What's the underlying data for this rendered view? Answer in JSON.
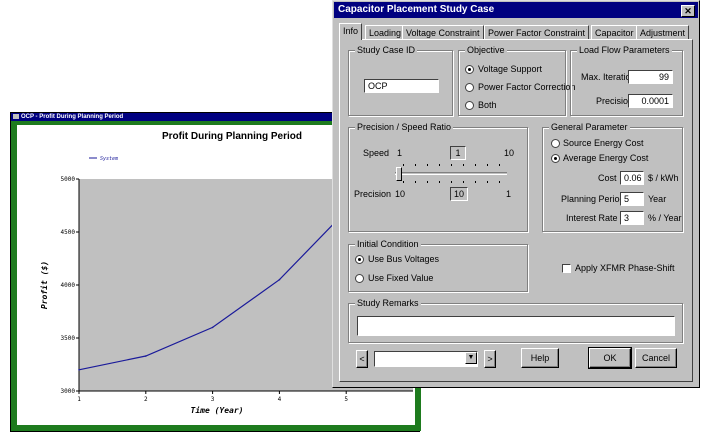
{
  "chart_window": {
    "title": "OCP - Profit During Planning Period"
  },
  "chart_data": {
    "type": "line",
    "title": "Profit During Planning Period",
    "xlabel": "Time (Year)",
    "ylabel": "Profit ($)",
    "x": [
      1,
      2,
      3,
      4,
      5
    ],
    "series": [
      {
        "name": "System",
        "values": [
          3200,
          3330,
          3600,
          4050,
          4700
        ]
      }
    ],
    "x_ticks": [
      "1",
      "2",
      "3",
      "4",
      "5"
    ],
    "y_ticks": [
      "3000",
      "3500",
      "4000",
      "4500",
      "5000"
    ],
    "ylim": [
      3000,
      5000
    ],
    "xlim": [
      1,
      6
    ],
    "grid": false,
    "legend": "top-left",
    "plot_bg": "#c0c0c0",
    "line_color": "#1a1a9a"
  },
  "dialog": {
    "title": "Capacitor Placement Study Case",
    "close_icon": "close-icon",
    "tabs": [
      "Info",
      "Loading",
      "Voltage Constraint",
      "Power Factor Constraint",
      "Capacitor",
      "Adjustment"
    ],
    "active_tab": "Info",
    "study_case_id": {
      "label": "Study Case ID",
      "value": "OCP"
    },
    "objective": {
      "label": "Objective",
      "options": [
        "Voltage Support",
        "Power Factor Correction",
        "Both"
      ],
      "selected": "Voltage Support"
    },
    "load_flow": {
      "label": "Load Flow Parameters",
      "max_iteration_label": "Max. Iteration",
      "max_iteration": "99",
      "precision_label": "Precision",
      "precision": "0.0001"
    },
    "precision_speed": {
      "label": "Precision / Speed Ratio",
      "speed_label": "Speed",
      "speed_min": "1",
      "speed_value": "1",
      "speed_max": "10",
      "precision_label": "Precision",
      "precision_min": "10",
      "precision_value": "10",
      "precision_max": "1",
      "slider_level": 0.0
    },
    "general_parameter": {
      "label": "General Parameter",
      "options": [
        "Source Energy Cost",
        "Average Energy Cost"
      ],
      "selected": "Average Energy Cost",
      "cost_label": "Cost",
      "cost": "0.06",
      "cost_unit": "$ / kWh",
      "period_label": "Planning Period",
      "period": "5",
      "period_unit": "Year",
      "interest_label": "Interest Rate",
      "interest": "3",
      "interest_unit": "% / Year"
    },
    "initial_condition": {
      "label": "Initial Condition",
      "options": [
        "Use Bus Voltages",
        "Use Fixed Value"
      ],
      "selected": "Use Bus Voltages"
    },
    "phase_shift": {
      "label": "Apply XFMR Phase-Shift",
      "checked": false
    },
    "remarks": {
      "label": "Study Remarks",
      "value": ""
    },
    "nav": {
      "prev": "<",
      "next": ">",
      "dropdown_value": ""
    },
    "buttons": {
      "help": "Help",
      "ok": "OK",
      "cancel": "Cancel"
    }
  }
}
